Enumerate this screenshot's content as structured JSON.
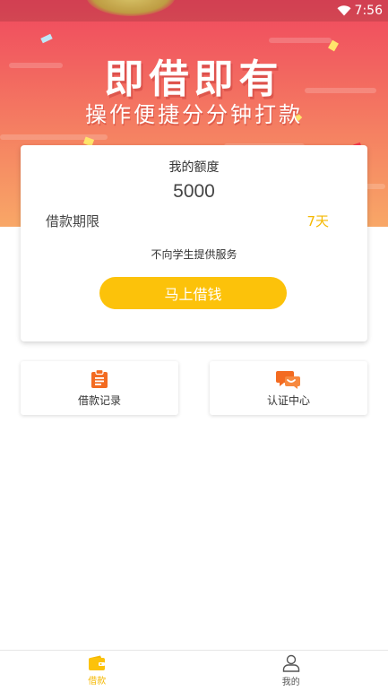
{
  "status_bar": {
    "time": "7:56",
    "wifi_icon": "wifi-icon"
  },
  "banner": {
    "headline": "即借即有",
    "subline": "操作便捷分分钟打款"
  },
  "loan_card": {
    "quota_label": "我的额度",
    "quota_value": "5000",
    "term_label": "借款期限",
    "term_value": "7天",
    "notice": "不向学生提供服务",
    "borrow_button": "马上借钱"
  },
  "tiles": {
    "records": {
      "label": "借款记录",
      "icon": "clipboard-icon"
    },
    "auth": {
      "label": "认证中心",
      "icon": "chat-bubbles-icon"
    }
  },
  "tabbar": {
    "tabs": [
      {
        "label": "借款",
        "icon": "wallet-icon",
        "active": true
      },
      {
        "label": "我的",
        "icon": "user-icon",
        "active": false
      }
    ]
  },
  "colors": {
    "accent": "#fcc20a",
    "term_value": "#f5b800",
    "banner_top": "#f0485e",
    "banner_bottom": "#f8a767",
    "tile_icon": "#f36b21"
  }
}
